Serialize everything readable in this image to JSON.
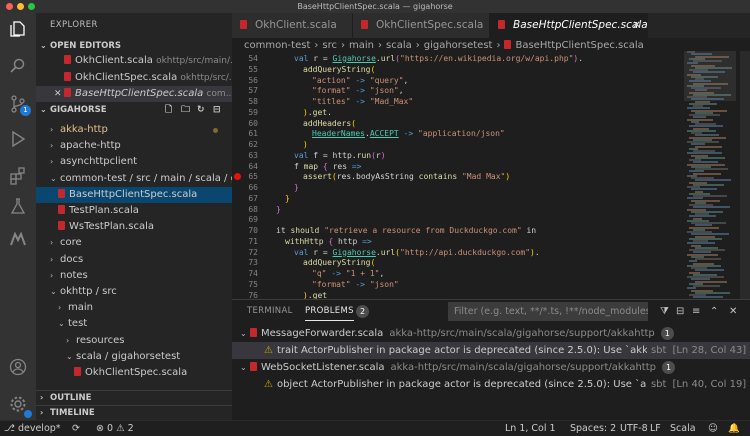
{
  "window": {
    "title": "BaseHttpClientSpec.scala — gigahorse"
  },
  "activity_bar": {
    "scm_badge": "1"
  },
  "explorer": {
    "title": "EXPLORER",
    "open_editors_label": "OPEN EDITORS",
    "open_editors": [
      {
        "name": "OkhClient.scala",
        "path": "okhttp/src/main/..."
      },
      {
        "name": "OkhClientSpec.scala",
        "path": "okhttp/src/..."
      },
      {
        "name": "BaseHttpClientSpec.scala",
        "path": "com..."
      }
    ],
    "workspace_label": "GIGAHORSE",
    "tree": [
      {
        "label": "akka-http",
        "chevron": "›",
        "indent": 1,
        "color": "#e2c08d",
        "dot": true
      },
      {
        "label": "apache-http",
        "chevron": "›",
        "indent": 1
      },
      {
        "label": "asynchttpclient",
        "chevron": "›",
        "indent": 1
      },
      {
        "label": "common-test / src / main / scala / gigahorsetest",
        "chevron": "⌄",
        "indent": 1
      },
      {
        "label": "BaseHttpClientSpec.scala",
        "file": true,
        "indent": 2,
        "state": "hl"
      },
      {
        "label": "TestPlan.scala",
        "file": true,
        "indent": 2
      },
      {
        "label": "WsTestPlan.scala",
        "file": true,
        "indent": 2
      },
      {
        "label": "core",
        "chevron": "›",
        "indent": 1
      },
      {
        "label": "docs",
        "chevron": "›",
        "indent": 1
      },
      {
        "label": "notes",
        "chevron": "›",
        "indent": 1
      },
      {
        "label": "okhttp / src",
        "chevron": "⌄",
        "indent": 1
      },
      {
        "label": "main",
        "chevron": "›",
        "indent": 2
      },
      {
        "label": "test",
        "chevron": "⌄",
        "indent": 2
      },
      {
        "label": "resources",
        "chevron": "›",
        "indent": 3
      },
      {
        "label": "scala / gigahorsetest",
        "chevron": "⌄",
        "indent": 3
      },
      {
        "label": "OkhClientSpec.scala",
        "file": true,
        "indent": 4
      }
    ],
    "outline_label": "OUTLINE",
    "timeline_label": "TIMELINE"
  },
  "editor": {
    "tabs": [
      {
        "label": "OkhClient.scala"
      },
      {
        "label": "OkhClientSpec.scala"
      },
      {
        "label": "BaseHttpClientSpec.scala",
        "active": true
      }
    ],
    "breadcrumb": [
      "common-test",
      "src",
      "main",
      "scala",
      "gigahorsetest",
      "BaseHttpClientSpec.scala"
    ],
    "breadcrumb_sep": "›",
    "lines": [
      {
        "n": "54",
        "indent": 6,
        "tokens": [
          [
            "kw",
            "val "
          ],
          [
            "",
            "r = "
          ],
          [
            "ty",
            "Gigahorse"
          ],
          [
            "",
            "."
          ],
          [
            "fn",
            "url"
          ],
          [
            "br",
            "("
          ],
          [
            "st",
            "\"https://en.wikipedia.org/w/api.php\""
          ],
          [
            "br",
            ")"
          ],
          [
            "",
            "."
          ]
        ]
      },
      {
        "n": "55",
        "indent": 7,
        "tokens": [
          [
            "fn",
            "addQueryString"
          ],
          [
            "br2",
            "("
          ]
        ]
      },
      {
        "n": "56",
        "indent": 8,
        "tokens": [
          [
            "st",
            "\"action\""
          ],
          [
            "",
            " "
          ],
          [
            "kw",
            "->"
          ],
          [
            "",
            " "
          ],
          [
            "st",
            "\"query\""
          ],
          [
            "",
            ","
          ]
        ]
      },
      {
        "n": "57",
        "indent": 8,
        "tokens": [
          [
            "st",
            "\"format\""
          ],
          [
            "",
            " "
          ],
          [
            "kw",
            "->"
          ],
          [
            "",
            " "
          ],
          [
            "st",
            "\"json\""
          ],
          [
            "",
            ","
          ]
        ]
      },
      {
        "n": "58",
        "indent": 8,
        "tokens": [
          [
            "st",
            "\"titles\""
          ],
          [
            "",
            " "
          ],
          [
            "kw",
            "->"
          ],
          [
            "",
            " "
          ],
          [
            "st",
            "\"Mad_Max\""
          ]
        ]
      },
      {
        "n": "59",
        "indent": 7,
        "tokens": [
          [
            "br2",
            ")"
          ],
          [
            "",
            "."
          ],
          [
            "fn",
            "get"
          ],
          [
            "",
            "."
          ]
        ]
      },
      {
        "n": "60",
        "indent": 7,
        "tokens": [
          [
            "fn",
            "addHeaders"
          ],
          [
            "br2",
            "("
          ]
        ]
      },
      {
        "n": "61",
        "indent": 8,
        "tokens": [
          [
            "ty",
            "HeaderNames"
          ],
          [
            "",
            "."
          ],
          [
            "ty",
            "ACCEPT"
          ],
          [
            "",
            " "
          ],
          [
            "kw",
            "->"
          ],
          [
            "",
            " "
          ],
          [
            "st",
            "\"application/json\""
          ]
        ]
      },
      {
        "n": "62",
        "indent": 7,
        "tokens": [
          [
            "br2",
            ")"
          ]
        ]
      },
      {
        "n": "63",
        "indent": 6,
        "tokens": [
          [
            "kw",
            "val "
          ],
          [
            "",
            "f = http."
          ],
          [
            "fn",
            "run"
          ],
          [
            "br",
            "("
          ],
          [
            "",
            "r"
          ],
          [
            "br",
            ")"
          ]
        ]
      },
      {
        "n": "64",
        "indent": 6,
        "tokens": [
          [
            "",
            "f "
          ],
          [
            "fn",
            "map"
          ],
          [
            "",
            " "
          ],
          [
            "br",
            "{"
          ],
          [
            "",
            " res "
          ],
          [
            "kw",
            "=>"
          ]
        ]
      },
      {
        "n": "65",
        "indent": 7,
        "tokens": [
          [
            "fn",
            "assert"
          ],
          [
            "br2",
            "("
          ],
          [
            "",
            "res.bodyAsString "
          ],
          [
            "fn",
            "contains"
          ],
          [
            "",
            " "
          ],
          [
            "st",
            "\"Mad Max\""
          ],
          [
            "br2",
            ")"
          ]
        ],
        "breakpoint": true
      },
      {
        "n": "66",
        "indent": 6,
        "tokens": [
          [
            "br",
            "}"
          ]
        ]
      },
      {
        "n": "67",
        "indent": 5,
        "tokens": [
          [
            "br2",
            "}"
          ]
        ]
      },
      {
        "n": "68",
        "indent": 4,
        "tokens": [
          [
            "br",
            "}"
          ]
        ]
      },
      {
        "n": "69",
        "indent": 0,
        "tokens": []
      },
      {
        "n": "70",
        "indent": 4,
        "tokens": [
          [
            "",
            "it "
          ],
          [
            "fn",
            "should"
          ],
          [
            "",
            " "
          ],
          [
            "st",
            "\"retrieve a resource from Duckduckgo.com\""
          ],
          [
            "",
            " in"
          ]
        ]
      },
      {
        "n": "71",
        "indent": 5,
        "tokens": [
          [
            "fn",
            "withHttp"
          ],
          [
            "",
            " "
          ],
          [
            "br",
            "{"
          ],
          [
            "",
            " http "
          ],
          [
            "kw",
            "=>"
          ]
        ]
      },
      {
        "n": "72",
        "indent": 6,
        "tokens": [
          [
            "kw",
            "val "
          ],
          [
            "",
            "r = "
          ],
          [
            "ty",
            "Gigahorse"
          ],
          [
            "",
            "."
          ],
          [
            "fn",
            "url"
          ],
          [
            "br2",
            "("
          ],
          [
            "st",
            "\"http://api.duckduckgo.com\""
          ],
          [
            "br2",
            ")"
          ],
          [
            "",
            "."
          ]
        ]
      },
      {
        "n": "73",
        "indent": 7,
        "tokens": [
          [
            "fn",
            "addQueryString"
          ],
          [
            "br2",
            "("
          ]
        ]
      },
      {
        "n": "74",
        "indent": 8,
        "tokens": [
          [
            "st",
            "\"q\""
          ],
          [
            "",
            " "
          ],
          [
            "kw",
            "->"
          ],
          [
            "",
            " "
          ],
          [
            "st",
            "\"1 + 1\""
          ],
          [
            "",
            ","
          ]
        ]
      },
      {
        "n": "75",
        "indent": 8,
        "tokens": [
          [
            "st",
            "\"format\""
          ],
          [
            "",
            " "
          ],
          [
            "kw",
            "->"
          ],
          [
            "",
            " "
          ],
          [
            "st",
            "\"json\""
          ]
        ]
      },
      {
        "n": "76",
        "indent": 7,
        "tokens": [
          [
            "br2",
            ")"
          ],
          [
            "",
            "."
          ],
          [
            "fn",
            "get"
          ]
        ]
      }
    ]
  },
  "panel": {
    "tabs": {
      "terminal": "TERMINAL",
      "problems": "PROBLEMS",
      "problems_count": "2"
    },
    "filter_placeholder": "Filter (e.g. text, **/*.ts, !**/node_modules/**)",
    "groups": [
      {
        "file": "MessageForwarder.scala",
        "path": "akka-http/src/main/scala/gigahorse/support/akkahttp",
        "count": "1",
        "problem": {
          "message": "trait ActorPublisher in package actor is deprecated (since 2.5.0): Use `akka.strea...",
          "source": "sbt",
          "location": "[Ln 28, Col 43]"
        }
      },
      {
        "file": "WebSocketListener.scala",
        "path": "akka-http/src/main/scala/gigahorse/support/akkahttp",
        "count": "1",
        "problem": {
          "message": "object ActorPublisher in package actor is deprecated (since 2.5.0): Use `akka.strea...",
          "source": "sbt",
          "location": "[Ln 40, Col 19]"
        }
      }
    ]
  },
  "status": {
    "branch": "develop*",
    "sync": "⟳",
    "errors": "0",
    "warnings": "2",
    "position": "Ln 1, Col 1",
    "spaces": "Spaces: 2",
    "encoding": "UTF-8",
    "eol": "LF",
    "language": "Scala"
  }
}
